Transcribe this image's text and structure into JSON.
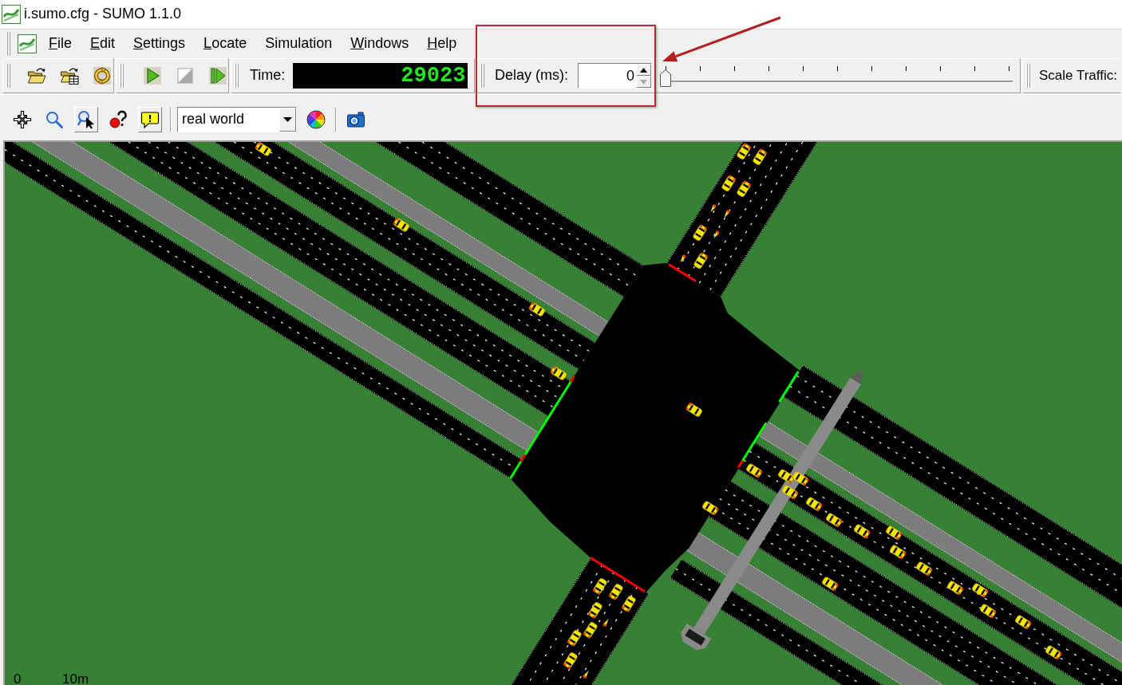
{
  "window": {
    "title": "i.sumo.cfg - SUMO 1.1.0"
  },
  "menu": [
    {
      "label": "File",
      "mnemonic": true
    },
    {
      "label": "Edit",
      "mnemonic": true
    },
    {
      "label": "Settings",
      "mnemonic": true
    },
    {
      "label": "Locate",
      "mnemonic": true
    },
    {
      "label": "Simulation",
      "mnemonic": false
    },
    {
      "label": "Windows",
      "mnemonic": true
    },
    {
      "label": "Help",
      "mnemonic": true
    }
  ],
  "simulation_buttons": [
    {
      "kind": "run",
      "disabled": false
    },
    {
      "kind": "stop",
      "disabled": true
    },
    {
      "kind": "step",
      "disabled": false
    }
  ],
  "time": {
    "label": "Time:",
    "value": "29023"
  },
  "delay": {
    "label": "Delay (ms):",
    "value": "0",
    "decrement_disabled": true,
    "level": 0
  },
  "scale_traffic": {
    "label": "Scale Traffic:"
  },
  "view_tools": [
    {
      "kind": "recenter",
      "raised": false
    },
    {
      "kind": "zoom",
      "raised": false
    },
    {
      "kind": "locate",
      "raised": true
    },
    {
      "kind": "query",
      "raised": false
    },
    {
      "kind": "tooltip",
      "raised": true
    }
  ],
  "color_scheme": {
    "value": "real world"
  },
  "map": {
    "signals": [
      {
        "color": "#ff0000"
      },
      {
        "color": "#ff0000"
      },
      {
        "color": "#00ff00"
      },
      {
        "color": "#ff0000"
      },
      {
        "color": "#00ff00"
      },
      {
        "color": "#00ff00"
      },
      {
        "color": "#00ff00"
      },
      {
        "color": "#ff0000"
      },
      {
        "color": "#ff0000"
      }
    ],
    "scale": [
      "0",
      "10m"
    ]
  },
  "annotations": [
    {
      "kind": "box"
    },
    {
      "kind": "arrow"
    }
  ]
}
